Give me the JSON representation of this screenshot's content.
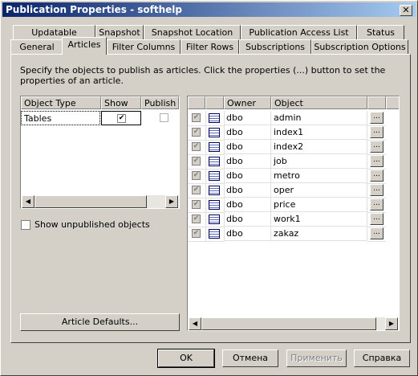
{
  "window": {
    "title": "Publication Properties - softhelp",
    "close_glyph": "✕"
  },
  "tabs_row1": [
    {
      "label": "Updatable"
    },
    {
      "label": "Snapshot"
    },
    {
      "label": "Snapshot Location"
    },
    {
      "label": "Publication Access List"
    },
    {
      "label": "Status"
    }
  ],
  "tabs_row2": [
    {
      "label": "General"
    },
    {
      "label": "Articles",
      "active": true
    },
    {
      "label": "Filter Columns"
    },
    {
      "label": "Filter Rows"
    },
    {
      "label": "Subscriptions"
    },
    {
      "label": "Subscription Options"
    }
  ],
  "description": "Specify the objects to publish as articles. Click the properties (...) button to set the properties of an article.",
  "type_list": {
    "columns": [
      "Object Type",
      "Show",
      "Publish A"
    ],
    "rows": [
      {
        "type": "Tables",
        "show": true,
        "publish_all": false
      }
    ]
  },
  "show_unpublished": {
    "label": "Show unpublished objects",
    "checked": false
  },
  "article_defaults_label": "Article Defaults...",
  "object_list": {
    "columns": [
      "",
      "",
      "Owner",
      "Object",
      ""
    ],
    "rows": [
      {
        "owner": "dbo",
        "object": "admin",
        "checked": true
      },
      {
        "owner": "dbo",
        "object": "index1",
        "checked": true
      },
      {
        "owner": "dbo",
        "object": "index2",
        "checked": true
      },
      {
        "owner": "dbo",
        "object": "job",
        "checked": true
      },
      {
        "owner": "dbo",
        "object": "metro",
        "checked": true
      },
      {
        "owner": "dbo",
        "object": "oper",
        "checked": true
      },
      {
        "owner": "dbo",
        "object": "price",
        "checked": true
      },
      {
        "owner": "dbo",
        "object": "work1",
        "checked": true
      },
      {
        "owner": "dbo",
        "object": "zakaz",
        "checked": true
      }
    ],
    "ellipsis": "..."
  },
  "buttons": {
    "ok": "OK",
    "cancel": "Отмена",
    "apply": "Применить",
    "help": "Справка"
  },
  "glyphs": {
    "check": "✔",
    "left": "◀",
    "right": "▶"
  }
}
